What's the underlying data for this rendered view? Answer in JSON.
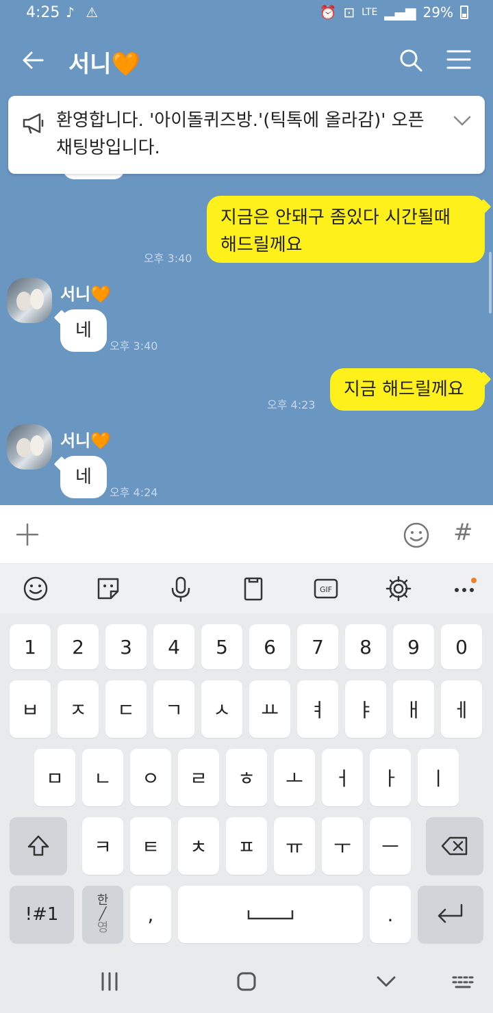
{
  "status_bar": {
    "time": "4:25",
    "network": "LTE",
    "battery": "29%"
  },
  "header": {
    "title": "서니🧡"
  },
  "notice": {
    "text": "환영합니다. '아이돌퀴즈방.'(틱톡에 올라감)' 오픈채팅방입니다."
  },
  "messages": [
    {
      "side": "me",
      "text": "지금은 안돼구 좀있다 시간될때 해드릴께요",
      "time": "오후 3:40"
    },
    {
      "side": "them",
      "sender": "서니🧡",
      "text": "네",
      "time": "오후 3:40"
    },
    {
      "side": "me",
      "text": "지금 해드릴께요",
      "time": "오후 4:23"
    },
    {
      "side": "them",
      "sender": "서니🧡",
      "text": "네",
      "time": "오후 4:24"
    }
  ],
  "input": {
    "placeholder": "",
    "hash_label": "#"
  },
  "keyboard": {
    "row_numbers": [
      "1",
      "2",
      "3",
      "4",
      "5",
      "6",
      "7",
      "8",
      "9",
      "0"
    ],
    "row_1": [
      "ㅂ",
      "ㅈ",
      "ㄷ",
      "ㄱ",
      "ㅅ",
      "ㅛ",
      "ㅕ",
      "ㅑ",
      "ㅐ",
      "ㅔ"
    ],
    "row_2": [
      "ㅁ",
      "ㄴ",
      "ㅇ",
      "ㄹ",
      "ㅎ",
      "ㅗ",
      "ㅓ",
      "ㅏ",
      "ㅣ"
    ],
    "row_3": [
      "ㅋ",
      "ㅌ",
      "ㅊ",
      "ㅍ",
      "ㅠ",
      "ㅜ",
      "ㅡ"
    ],
    "symbols_label": "!#1",
    "lang_top": "한",
    "lang_bottom": "영",
    "comma_label": ",",
    "period_label": "."
  },
  "icons": {
    "status": [
      "tiktok-icon",
      "warning-icon",
      "alarm-icon",
      "saver-icon",
      "signal-icon",
      "battery-icon"
    ],
    "toolbar": [
      "emoji-icon",
      "sticker-icon",
      "mic-icon",
      "clipboard-icon",
      "gif-icon",
      "settings-icon",
      "more-icon"
    ]
  },
  "colors": {
    "chat_bg": "#6a96c2",
    "my_bubble": "#fef01b",
    "their_bubble": "#ffffff",
    "notification_dot": "#f07e2b"
  }
}
